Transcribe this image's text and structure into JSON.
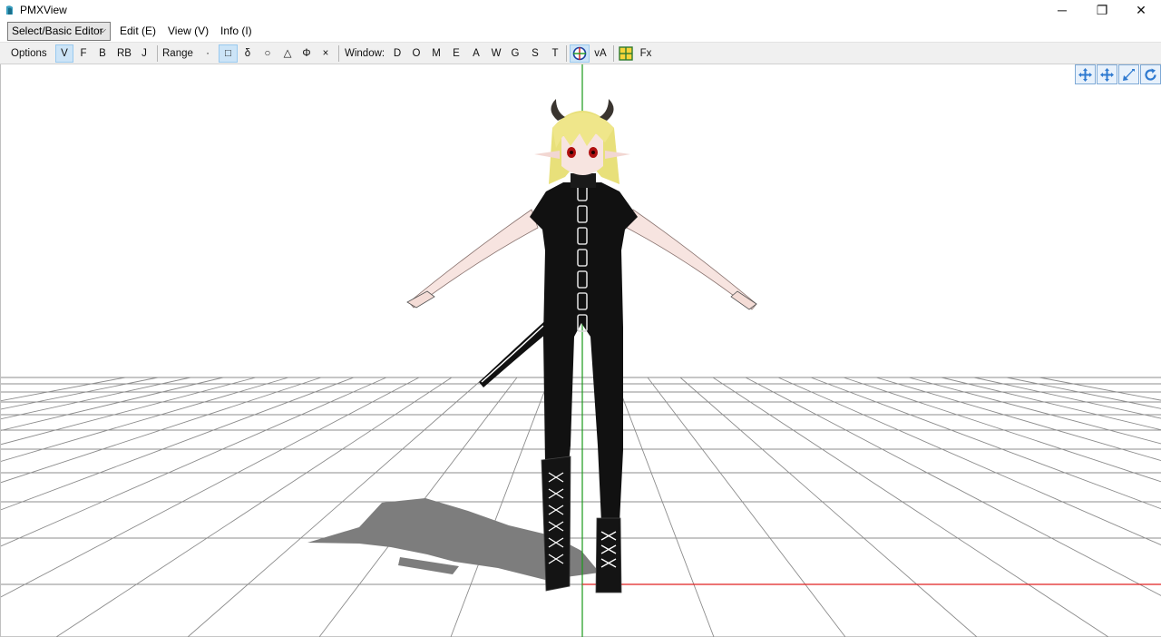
{
  "window": {
    "title": "PMXView",
    "minimize_glyph": "─",
    "maximize_glyph": "❐",
    "close_glyph": "✕"
  },
  "menubar": {
    "mode_select_value": "Select/Basic Editor",
    "items": [
      "Edit (E)",
      "View (V)",
      "Info (I)"
    ]
  },
  "toolbar": {
    "options_label": "Options :",
    "options": [
      "V",
      "F",
      "B",
      "RB",
      "J"
    ],
    "options_active": "V",
    "range_label": "Range :",
    "range_items": [
      "·",
      "□",
      "δ",
      "○",
      "△",
      "Φ",
      "×"
    ],
    "range_active": "□",
    "window_label": "Window:",
    "window_items": [
      "D",
      "O",
      "M",
      "E",
      "A",
      "W",
      "G",
      "S",
      "T"
    ],
    "va_label": "vA",
    "fx_label": "Fx"
  },
  "viewport": {
    "view_controls": [
      "rotate-view-icon",
      "pan-view-icon",
      "zoom-view-icon",
      "reset-view-icon"
    ],
    "axis_colors": {
      "y": "#1a9a1a",
      "x": "#e02020"
    },
    "grid_color": "#8c8c8c",
    "model_colors": {
      "hair": "#e8e07a",
      "outfit": "#111111",
      "skin": "#f7e4e0",
      "horn": "#3a3530"
    }
  }
}
